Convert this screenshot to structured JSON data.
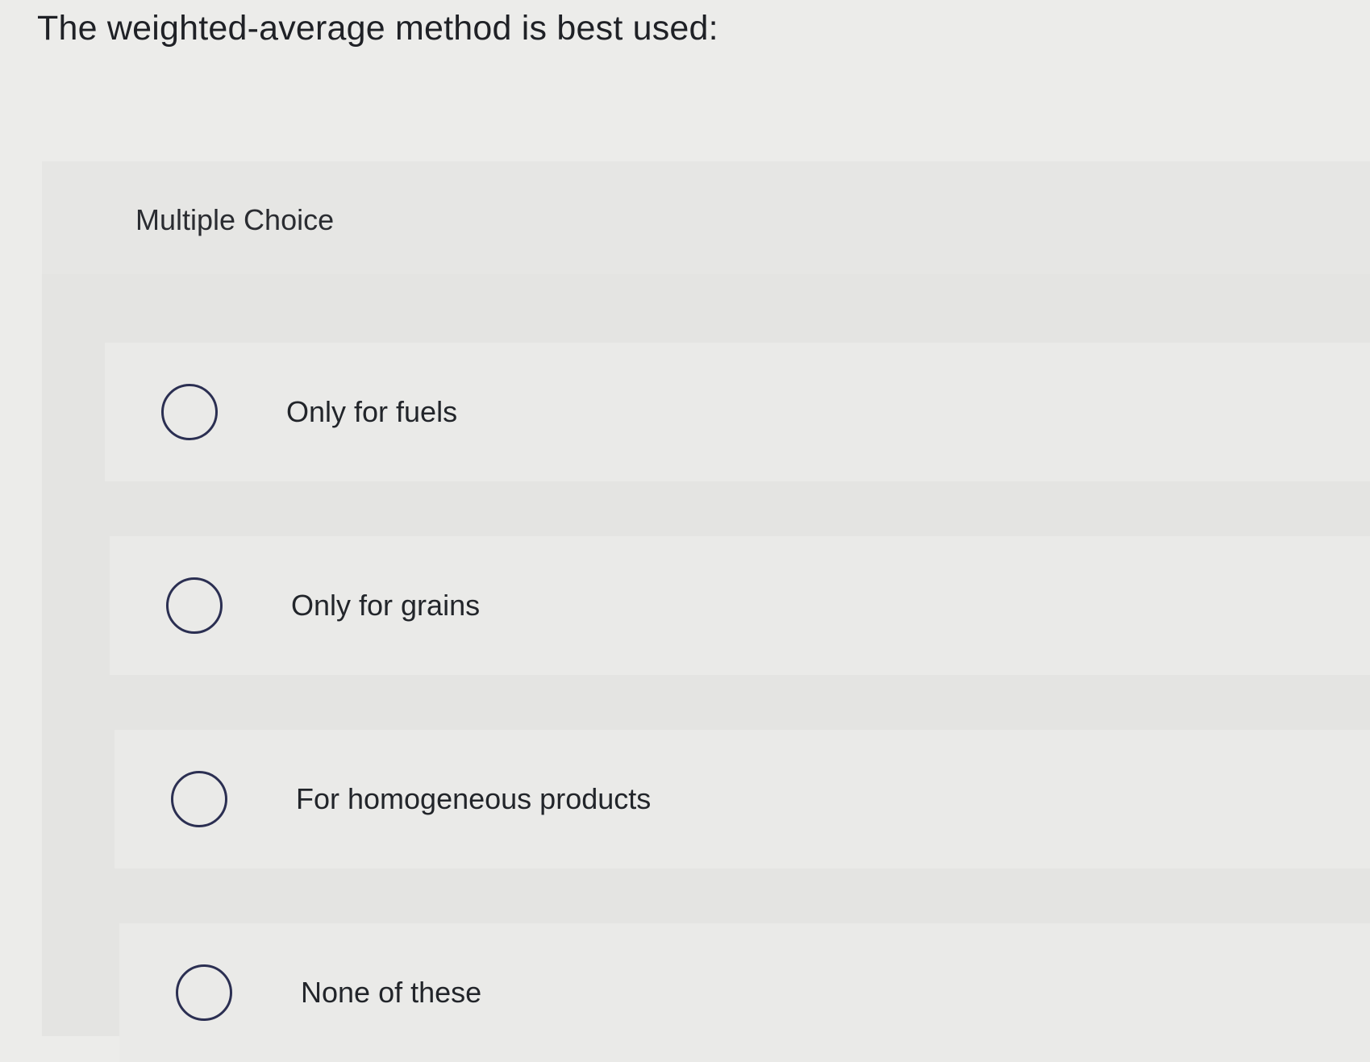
{
  "question": {
    "text": "The weighted-average method is best used:"
  },
  "panel": {
    "label": "Multiple Choice"
  },
  "options": [
    {
      "label": "Only for fuels",
      "selected": false
    },
    {
      "label": "Only for grains",
      "selected": false
    },
    {
      "label": "For homogeneous products",
      "selected": false
    },
    {
      "label": "None of these",
      "selected": false
    }
  ],
  "colors": {
    "background": "#ececea",
    "panel": "#e4e4e2",
    "radio_border": "#2b2f52",
    "text": "#1f2126"
  }
}
